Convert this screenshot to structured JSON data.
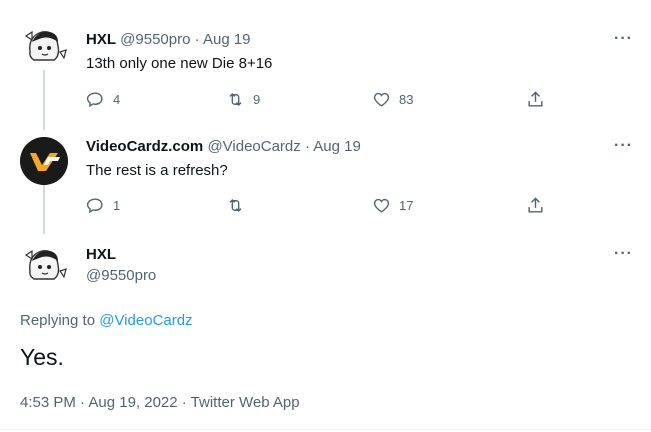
{
  "tweets": [
    {
      "name": "HXL",
      "handle": "@9550pro",
      "separator": "·",
      "date": "Aug 19",
      "text": "13th only one new Die 8+16",
      "replies": "4",
      "retweets": "9",
      "likes": "83",
      "more": "···"
    },
    {
      "name": "VideoCardz.com",
      "handle": "@VideoCardz",
      "separator": "·",
      "date": "Aug 19",
      "text": "The rest is a refresh?",
      "replies": "1",
      "retweets": "",
      "likes": "17",
      "more": "···"
    }
  ],
  "focus": {
    "name": "HXL",
    "handle": "@9550pro",
    "more": "···",
    "replying_prefix": "Replying to",
    "replying_handle": "@VideoCardz",
    "text": "Yes.",
    "meta": "4:53 PM · Aug 19, 2022 · Twitter Web App"
  },
  "colors": {
    "accent": "#1d9bf0",
    "muted": "#536471",
    "brand_gold": "#f5a623"
  },
  "icons": [
    "reply-icon",
    "retweet-icon",
    "like-icon",
    "share-icon",
    "more-icon"
  ]
}
